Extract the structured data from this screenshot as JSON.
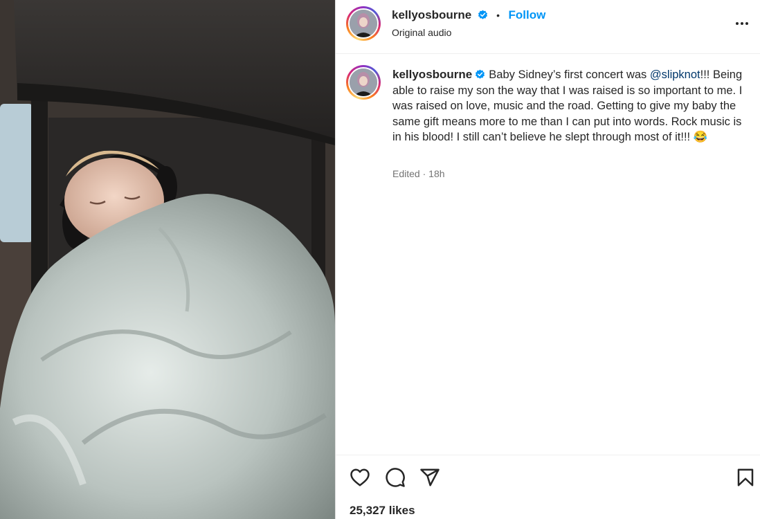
{
  "post": {
    "username": "kellyosbourne",
    "follow_label": "Follow",
    "separator": "•",
    "audio": "Original audio",
    "caption_part1": "Baby Sidney’s first concert was ",
    "mention": "@slipknot",
    "caption_part2": "!!! Being able to raise my son the way that I was raised is so important to me. I was raised on love, music and the road. Getting to give my baby the same gift means more to me than I can put into words. Rock music is in his blood! I still can’t believe he slept through most of it!!! 😂",
    "edited_label": "Edited",
    "time_separator": " · ",
    "timestamp": "18h",
    "likes": "25,327 likes"
  },
  "icons": {
    "more": "more-options-icon",
    "like": "heart-icon",
    "comment": "comment-icon",
    "share": "send-icon",
    "save": "bookmark-icon",
    "verified": "verified-badge-icon"
  },
  "colors": {
    "follow": "#0095f6",
    "verified": "#0095f6",
    "mention": "#00376b",
    "muted": "#737373"
  }
}
